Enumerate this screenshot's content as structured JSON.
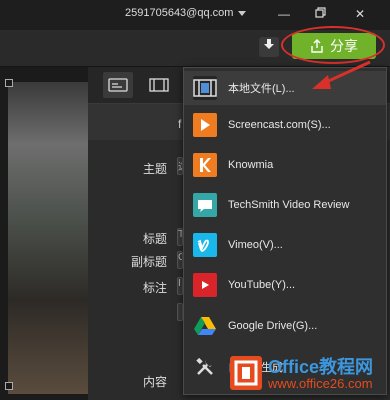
{
  "titlebar": {
    "account": "2591705643@qq.com"
  },
  "toolbar": {
    "share_label": "分享"
  },
  "panel": {
    "header_text": "f",
    "labels": {
      "theme": "主题",
      "title": "标题",
      "subtitle": "副标题",
      "annotation": "标注",
      "content": "内容"
    },
    "stubs": {
      "theme": "这",
      "title": "T",
      "subtitle": "C",
      "annotation": "I"
    }
  },
  "menu": {
    "items": [
      {
        "label": "本地文件(L)...",
        "icon": "local-file-icon",
        "color": "#2a2a2a"
      },
      {
        "label": "Screencast.com(S)...",
        "icon": "screencast-icon",
        "color": "#f07c21"
      },
      {
        "label": "Knowmia",
        "icon": "knowmia-icon",
        "color": "#f07c21"
      },
      {
        "label": "TechSmith Video Review",
        "icon": "video-review-icon",
        "color": "#35a7a6"
      },
      {
        "label": "Vimeo(V)...",
        "icon": "vimeo-icon",
        "color": "#1ab7ea"
      },
      {
        "label": "YouTube(Y)...",
        "icon": "youtube-icon",
        "color": "#d9252a"
      },
      {
        "label": "Google Drive(G)...",
        "icon": "google-drive-icon",
        "color": "#ffffff"
      },
      {
        "label": "自定义生成",
        "icon": "tools-icon",
        "color": "#2a2a2a"
      }
    ]
  },
  "watermark": {
    "title": "Office教程网",
    "url": "www.office26.com",
    "logo": "office-logo"
  },
  "colors": {
    "accent": "#70b32a",
    "annotation_red": "#d9302a"
  }
}
